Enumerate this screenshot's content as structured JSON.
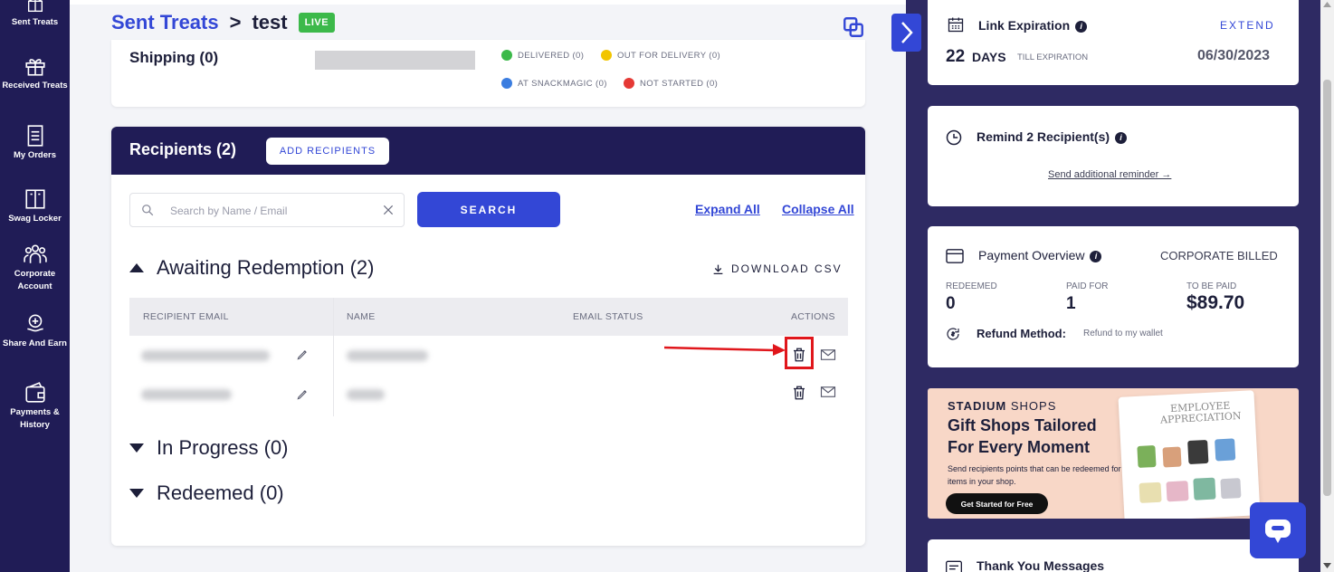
{
  "sidebar": {
    "items": [
      {
        "label": "Sent Treats",
        "icon": "gift-box-icon"
      },
      {
        "label": "Received Treats",
        "icon": "gift-icon"
      },
      {
        "label": "My Orders",
        "icon": "receipt-icon"
      },
      {
        "label": "Swag Locker",
        "icon": "locker-icon"
      },
      {
        "label": "Corporate Account",
        "icon": "team-icon"
      },
      {
        "label": "Share And Earn",
        "icon": "share-hand-icon"
      },
      {
        "label": "Payments & History",
        "icon": "wallet-icon"
      }
    ]
  },
  "header": {
    "breadcrumb_parent": "Sent Treats",
    "separator": ">",
    "current": "test",
    "status_badge": "LIVE"
  },
  "shipping": {
    "title": "Shipping (0)",
    "legend": [
      {
        "label": "DELIVERED (0)",
        "color": "#3cb94a"
      },
      {
        "label": "OUT FOR DELIVERY (0)",
        "color": "#f2c500"
      },
      {
        "label": "AT SNACKMAGIC (0)",
        "color": "#3b7de0"
      },
      {
        "label": "NOT STARTED (0)",
        "color": "#e53935"
      }
    ]
  },
  "recipients": {
    "title": "Recipients (2)",
    "add_button": "ADD RECIPIENTS",
    "search_placeholder": "Search by Name / Email",
    "search_button": "SEARCH",
    "expand_all": "Expand All",
    "collapse_all": "Collapse All",
    "download_csv": "DOWNLOAD CSV",
    "sections": {
      "awaiting": "Awaiting Redemption (2)",
      "in_progress": "In Progress (0)",
      "redeemed": "Redeemed (0)"
    },
    "columns": [
      "RECIPIENT EMAIL",
      "NAME",
      "EMAIL STATUS",
      "ACTIONS"
    ]
  },
  "right_panel": {
    "link_expiration": {
      "title": "Link Expiration",
      "extend": "EXTEND",
      "days_number": "22",
      "days_unit": "DAYS",
      "till": "TILL EXPIRATION",
      "date": "06/30/2023"
    },
    "remind": {
      "title": "Remind 2 Recipient(s)",
      "link": "Send additional reminder →"
    },
    "payment": {
      "title": "Payment Overview",
      "billing": "CORPORATE BILLED",
      "redeemed_label": "REDEEMED",
      "redeemed_value": "0",
      "paid_label": "PAID FOR",
      "paid_value": "1",
      "tobepaid_label": "TO BE PAID",
      "tobepaid_value": "$89.70",
      "refund_label": "Refund Method:",
      "refund_value": "Refund to my wallet"
    },
    "promo": {
      "brand_bold": "STADIUM",
      "brand_rest": " SHOPS",
      "headline_1": "Gift Shops Tailored",
      "headline_2": "For Every Moment",
      "body": "Send recipients points that can be redeemed for items in your shop.",
      "cta": "Get Started for Free",
      "image_title": "EMPLOYEE APPRECIATION"
    },
    "thank_you": {
      "title": "Thank You Messages"
    }
  },
  "colors": {
    "sidebar_bg": "#201c56",
    "accent": "#3347d6",
    "live": "#3cb94a",
    "highlight": "#e0161b"
  }
}
